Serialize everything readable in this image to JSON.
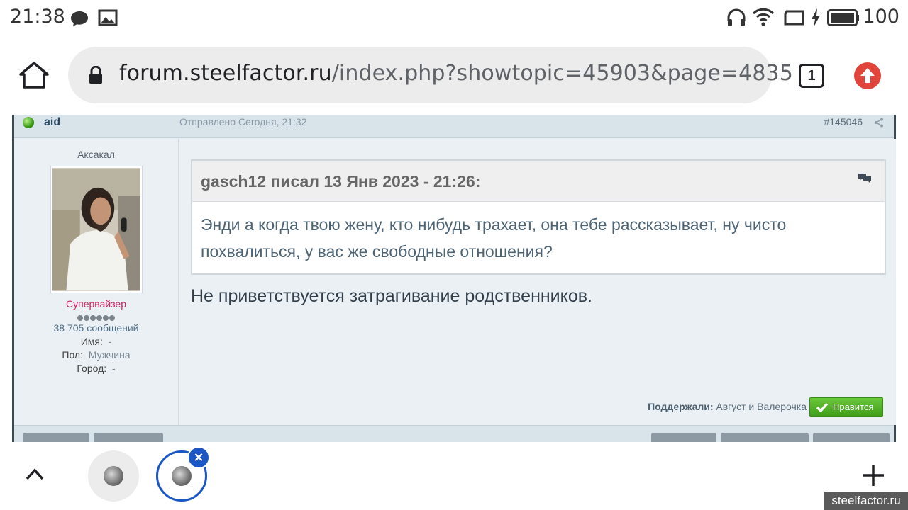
{
  "status_bar": {
    "time": "21:38",
    "battery_level": "100",
    "icons": [
      "chat-bubble-icon",
      "image-icon",
      "headphones-icon",
      "wifi-icon",
      "screen-cast-icon",
      "charging-bolt-icon",
      "battery-icon"
    ]
  },
  "browser": {
    "url_host": "forum.steelfactor.ru",
    "url_path": "/index.php?showtopic=45903&page=4835",
    "tab_count": "1"
  },
  "post": {
    "author": "aid",
    "posted_label": "Отправлено",
    "posted_date": "Сегодня, 21:32",
    "post_number": "#145046",
    "user": {
      "rank_title": "Аксакал",
      "group": "Супервайзер",
      "pips": 6,
      "messages": "38 705 сообщений",
      "name_label": "Имя:",
      "name_value": "-",
      "gender_label": "Пол:",
      "gender_value": "Мужчина",
      "city_label": "Город:",
      "city_value": "-"
    },
    "quote": {
      "cite": "gasch12 писал 13 Янв 2023 - 21:26:",
      "text": "Энди а когда твою жену, кто нибудь трахает, она тебе рассказывает, ну чисто похвалиться, у вас же свободные отношения?"
    },
    "text": "Не приветствуется затрагивание родственников.",
    "supported_label": "Поддержали:",
    "supported_by": "Август и Валерочка",
    "like_label": "Нравится"
  },
  "watermark": "steelfactor.ru",
  "colors": {
    "accent_blue": "#1a56c4",
    "update_red": "#e0443a",
    "group_pink": "#d1205f",
    "like_green": "#4aa920"
  }
}
